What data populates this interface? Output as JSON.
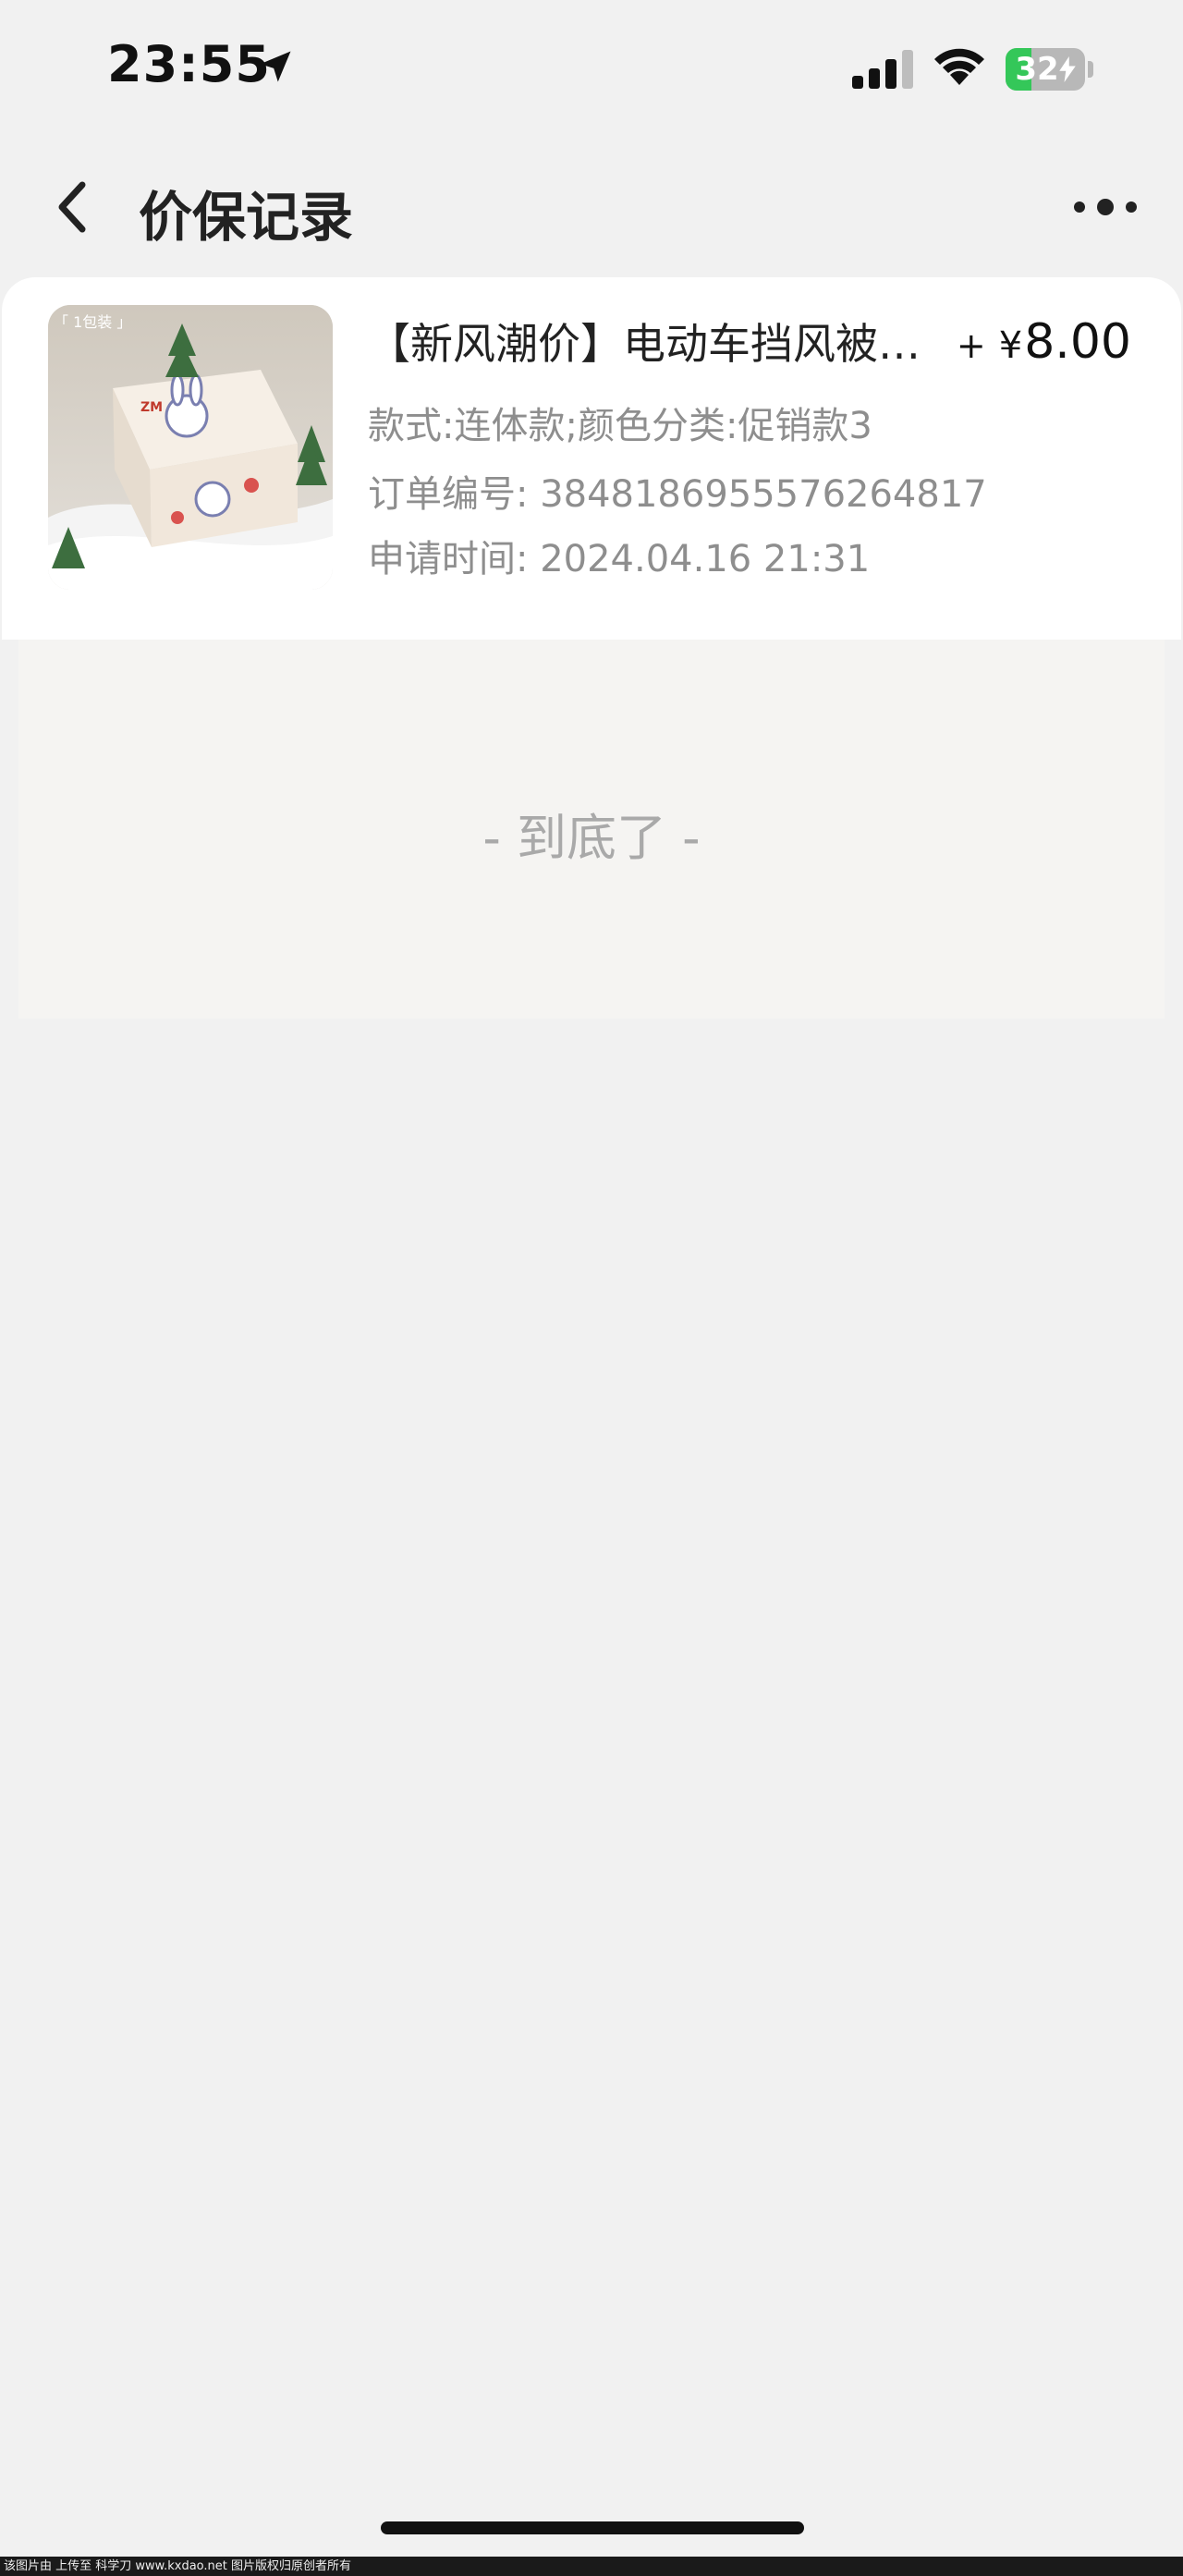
{
  "status_bar": {
    "time": "23:55",
    "battery_level": "32",
    "battery_fraction": 0.32
  },
  "nav": {
    "title": "价保记录"
  },
  "record": {
    "title": "【新风潮价】电动车挡风被冬季加厚加绒防水",
    "price_sign": "+",
    "price_currency": "¥",
    "price_value": "8.00",
    "spec": "款式:连体款;颜色分类:促销款3",
    "order_no": "订单编号: 3848186955576264817",
    "apply_time": "申请时间: 2024.04.16 21:31",
    "thumb_tag": "「 1包装 」",
    "thumb_brand": "ZM"
  },
  "list_end": {
    "text": "- 到底了 -"
  },
  "footer": {
    "text": "该图片由  上传至  科学刀  www.kxdao.net  图片版权归原创者所有"
  },
  "colors": {
    "background": "#f1f1f1",
    "card": "#ffffff",
    "muted_text": "#8e8e8e",
    "battery_green": "#34c759"
  }
}
